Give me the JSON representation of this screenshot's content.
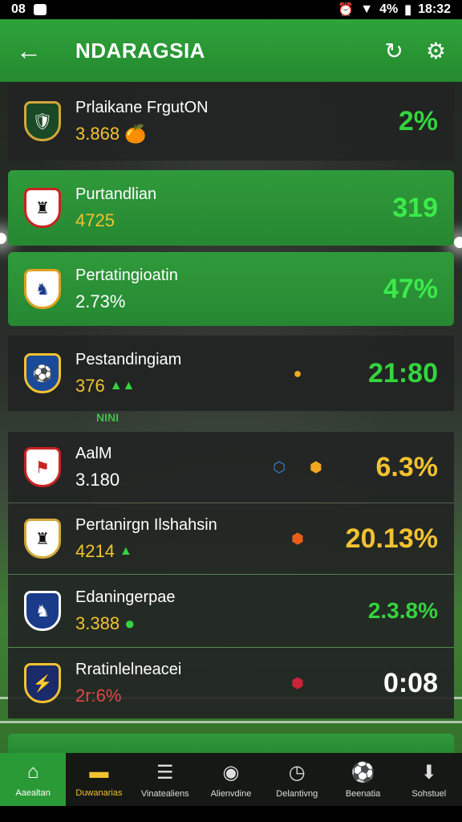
{
  "status_bar": {
    "time_left": "08",
    "battery": "4%",
    "time_right": "18:32"
  },
  "app_bar": {
    "title": "NDARAGSIA",
    "back_icon": "arrow-left-icon",
    "refresh_icon": "refresh-icon",
    "settings_icon": "gear-icon"
  },
  "rows": [
    {
      "name": "Prlaikane FrgutON",
      "sub": "3.868",
      "value": "2%"
    },
    {
      "name": "Purtandlian",
      "sub": "4725",
      "value": "319"
    },
    {
      "name": "Pertatingioatin",
      "sub": "2.73%",
      "value": "47%"
    },
    {
      "name": "Pestandingiam",
      "sub": "376",
      "value": "21:80"
    },
    {
      "name": "AalM",
      "sub": "3.180",
      "value": "6.3%"
    },
    {
      "name": "Pertanirgn Ilshahsin",
      "sub": "4214",
      "value": "20.13%"
    },
    {
      "name": "Edaningerpae",
      "sub": "3.388",
      "value": "2.3.8%"
    },
    {
      "name": "Rratinlelneacei",
      "sub": "2r:6%",
      "value": "0:08"
    }
  ],
  "section_label": "NINI",
  "bottom_nav": [
    {
      "label": "Aaealtan",
      "icon": "home-icon"
    },
    {
      "label": "Duwanarias",
      "icon": "ticket-icon"
    },
    {
      "label": "Vinatealiens",
      "icon": "news-icon"
    },
    {
      "label": "Alienvdine",
      "icon": "camera-icon"
    },
    {
      "label": "Delantivng",
      "icon": "clock-icon"
    },
    {
      "label": "Beenatia",
      "icon": "ball-icon"
    },
    {
      "label": "Sohstuel",
      "icon": "download-icon"
    }
  ]
}
